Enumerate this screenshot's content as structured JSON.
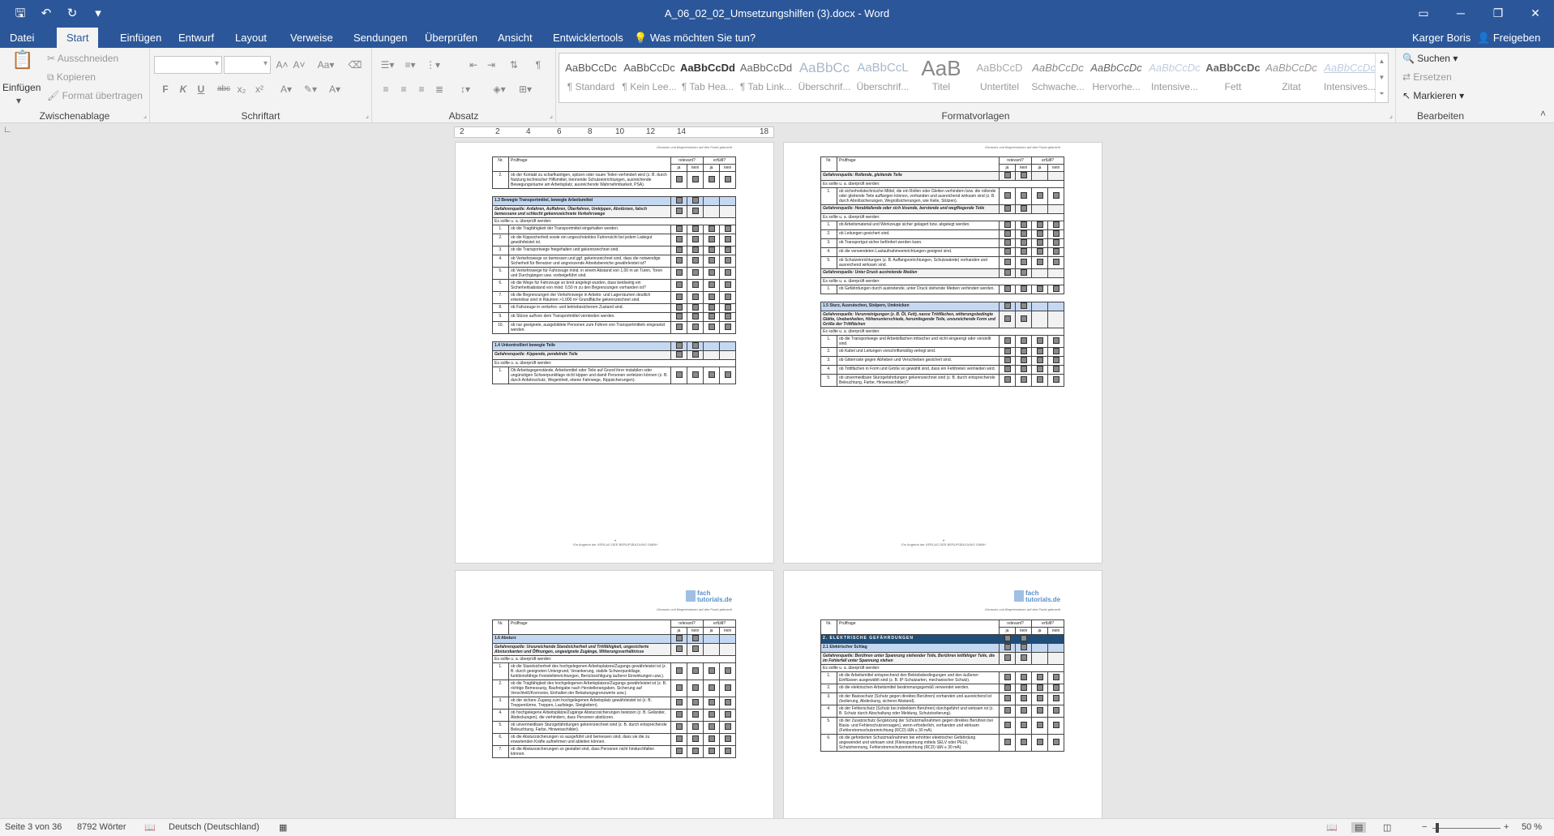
{
  "app": {
    "window_title": "A_06_02_02_Umsetzungshilfen (3).docx - Word",
    "qat": {
      "save": "save-icon",
      "undo": "undo-icon",
      "redo": "redo-icon",
      "customize": "customize-icon"
    },
    "user": "Karger Boris",
    "share": "Freigeben"
  },
  "tabs": [
    {
      "label": "Datei"
    },
    {
      "label": "Start"
    },
    {
      "label": "Einfügen"
    },
    {
      "label": "Entwurf"
    },
    {
      "label": "Layout"
    },
    {
      "label": "Verweise"
    },
    {
      "label": "Sendungen"
    },
    {
      "label": "Überprüfen"
    },
    {
      "label": "Ansicht"
    },
    {
      "label": "Entwicklertools"
    },
    {
      "label": "Was möchten Sie tun?"
    }
  ],
  "ribbon": {
    "clipboard": {
      "label": "Zwischenablage",
      "paste": "Einfügen",
      "cut": "Ausschneiden",
      "copy": "Kopieren",
      "format_painter": "Format übertragen"
    },
    "font": {
      "label": "Schriftart",
      "bold": "F",
      "italic": "K",
      "underline": "U",
      "strike": "abc",
      "sub": "x₂",
      "sup": "x²"
    },
    "paragraph": {
      "label": "Absatz"
    },
    "styles": {
      "label": "Formatvorlagen",
      "items": [
        {
          "preview": "AaBbCcDc",
          "name": "¶ Standard"
        },
        {
          "preview": "AaBbCcDc",
          "name": "¶ Kein Lee..."
        },
        {
          "preview": "AaBbCcDd",
          "name": "¶ Tab Hea..."
        },
        {
          "preview": "AaBbCcDd",
          "name": "¶ Tab Link..."
        },
        {
          "preview": "AaBbCc",
          "name": "Überschrif..."
        },
        {
          "preview": "AaBbCcL",
          "name": "Überschrif..."
        },
        {
          "preview": "AaB",
          "name": "Titel"
        },
        {
          "preview": "AaBbCcD",
          "name": "Untertitel"
        },
        {
          "preview": "AaBbCcDc",
          "name": "Schwache..."
        },
        {
          "preview": "AaBbCcDc",
          "name": "Hervorhe..."
        },
        {
          "preview": "AaBbCcDc",
          "name": "Intensive..."
        },
        {
          "preview": "AaBbCcDc",
          "name": "Fett"
        },
        {
          "preview": "AaBbCcDc",
          "name": "Zitat"
        },
        {
          "preview": "AaBbCcDc",
          "name": "Intensives..."
        }
      ]
    },
    "editing": {
      "label": "Bearbeiten",
      "find": "Suchen",
      "replace": "Ersetzen",
      "select": "Markieren"
    }
  },
  "ruler": {
    "numbers": [
      "2",
      "2",
      "4",
      "6",
      "8",
      "10",
      "12",
      "14",
      "18"
    ]
  },
  "pages": {
    "header_text": "Genaues vnb Begreensbsen auf den Punkt gebracht",
    "footer_text": "Ein Angebot der VERLAG DER BERUFSBILDUNG GMBH",
    "logo_text": "fach tutorials.de",
    "table_head": {
      "nr": "Nr.",
      "question": "Prüffrage",
      "relevant": "relevant?",
      "fulfilled": "erfüllt?",
      "ja": "ja",
      "nein": "nein"
    },
    "intro": "Es sollte u. a. überprüft werden:",
    "p1": {
      "rows": [
        {
          "nr": "2.",
          "text": "ob der Kontakt zu scharfkantigen, spitzen oder rauen Teilen verhindert wird (z. B. durch Nutzung technischer Hilfsmittel, trennende Schutzeinrichtungen, ausreichende Bewegungsräume am Arbeitsplatz, ausreichende Wahrnehmbarkeit, PSA)."
        }
      ],
      "sec1": "1.3 Bewegte Transportmittel, bewegte Arbeitsmittel",
      "haz1": "Gefahrenquelle: Anfahren, Auffahren, Überfahren, Umkippen, Abstürzen, falsch bemessene und schlecht gekennzeichnete Verkehrswege",
      "rows1": [
        {
          "nr": "1.",
          "text": "ob die Tragfähigkeit der Transportmittel eingehalten werden."
        },
        {
          "nr": "2.",
          "text": "ob die Kippsicherheit sowie ein ungeschränktes Fahrersicht bei jedem Ladegut gewährleistet ist."
        },
        {
          "nr": "3.",
          "text": "ob die Transportwege freigehalten und gekennzeichnet sind."
        },
        {
          "nr": "4.",
          "text": "ob Verkehrswege so bemessen und ggf. gekennzeichnet sind, dass die notwendige Sicherheit für Benutzer und angrenzende Arbeitsbereiche gewährleistet ist?"
        },
        {
          "nr": "5.",
          "text": "ob Verkehrswege für Fahrzeuge mind. in einem Abstand von 1,00 m an Türen, Toren und Durchgängen usw. vorbeigeführt sind."
        },
        {
          "nr": "6.",
          "text": "ob die Wege für Fahrzeuge so breit angelegt wurden, dass beidseitig ein Sicherheitsabstand von mind. 0,50 m zu den Begrenzungen vorhanden ist?"
        },
        {
          "nr": "7.",
          "text": "ob die Begrenzungen der Verkehrswege in Arbeits- und Lagerräumen deutlich erkennbar sind in Räumen >1.000 m² Grundfläche gekennzeichnet sind."
        },
        {
          "nr": "8.",
          "text": "ob Fahrzeuge in verkehrs- und betriebssicherem Zustand sind."
        },
        {
          "nr": "9.",
          "text": "ob Stürze auf/von dem Transportmittel vermieden werden."
        },
        {
          "nr": "10.",
          "text": "ob nur geeignete, ausgebildete Personen zum Führen von Transportmitteln eingesetzt werden."
        }
      ],
      "sec2": "1.4 Unkontrolliert bewegte Teile",
      "haz2": "Gefahrenquelle: Kippende, pendelnde Teile",
      "rows2": [
        {
          "nr": "1.",
          "text": "Ob Arbeitsgegenstände, Arbeitsmittel oder Teile auf Grund ihrer instabilen oder ungünstigen Schwerpunktlage nicht kippen und damit Personen verletzen können (z. B. durch Anfahrschutz, Wegeinheit, ebene Fahrwege, Kippsicherungen)."
        }
      ]
    },
    "p2": {
      "haz0": "Gefahrenquelle: Rollende, gleitende Teile",
      "rows0": [
        {
          "nr": "1.",
          "text": "ob sicherheitstechnische Mittel, die ein Rollen oder Gleiten verhindern bzw. die rollende oder gleitende Teile auffangen können, vorhanden und ausreichend wirksam sind (z. B. durch Abrollsicherungen, Wegrollsicherungen, wie Keile, Stützen)."
        }
      ],
      "haz1": "Gefahrenquelle: Herabfallende oder sich lösende, berstende und wegfliegende Teile",
      "rows1": [
        {
          "nr": "1.",
          "text": "ob Arbeitsmaterial und Werkzeuge sicher gelagert bzw. abgelegt werden."
        },
        {
          "nr": "2.",
          "text": "ob Leitungen gesichert sind."
        },
        {
          "nr": "3.",
          "text": "ob Transportgut sicher befördert werden kann."
        },
        {
          "nr": "4.",
          "text": "ob die verwendeten Lastaufnahmeeinrichtungen geeignet sind."
        },
        {
          "nr": "5.",
          "text": "ob Schutzeinrichtungen (z. B. Auffangvorrichtungen, Schutzwände) vorhanden und ausreichend wirksam sind."
        }
      ],
      "haz2": "Gefahrenquelle: Unter Druck austretende Medien",
      "rows2": [
        {
          "nr": "1.",
          "text": "ob Gefährdungen durch austretende, unter Druck stehende Medien verhindert werden."
        }
      ],
      "sec3": "1.5 Sturz, Ausrutschen, Stolpern, Umknicken",
      "haz3": "Gefahrenquelle: Verunreinigungen (z. B. Öl, Fett), nasse Trittflächen, witterungsbedingte Glätte, Unebenheiten, Höhenunterschiede, herumliegende Teile, unzureichende Form und Größe der Trittflächen",
      "rows3": [
        {
          "nr": "1.",
          "text": "ob die Transportwege und Arbeitsflächen trittsicher und nicht eingeengt oder verstellt sind."
        },
        {
          "nr": "2.",
          "text": "ob Kabel und Leitungen vorschriftsmäßig verlegt sind."
        },
        {
          "nr": "3.",
          "text": "ob Gitterroste gegen Abheben und Verschieben gesichert sind."
        },
        {
          "nr": "4.",
          "text": "ob Trittflächen in Form und Größe so gewählt sind, dass ein Fehltreten vermieden wird."
        },
        {
          "nr": "5.",
          "text": "ob unvermeidbare Sturzgefährdungen gekennzeichnet sind (z. B. durch entsprechende Beleuchtung, Farbe, Hinweisschilder)?"
        }
      ]
    },
    "p3": {
      "sec1": "1.6 Absturz",
      "haz1": "Gefahrenquelle: Unzureichende Standsicherheit und Trittfähigkeit, ungesicherte Absturzkanten und Öffnungen, ungeeignete Zugänge, Witterungsverhältnisse",
      "rows1": [
        {
          "nr": "1.",
          "text": "ob die Standsicherheit des hochgelegenen Arbeitsplatzes/Zugangs gewährleistet ist (z. B. durch geeigneten Untergrund, Verankerung, stabile Schwerpunktlage, funktionsfähige Feststelleinrichtungen, Berücksichtigung äußerer Einwirkungen usw.)."
        },
        {
          "nr": "2.",
          "text": "ob die Tragfähigkeit des hochgelegenen Arbeitsplatzes/Zugangs gewährleistet ist (z. B. richtige Bemessung, Baufreigabe nach Herstellerangaben, Sicherung auf Verschleiß/Korrosion, Einhalten der Belastungsgrenzwerte usw.)."
        },
        {
          "nr": "3.",
          "text": "ob der sichere Zugang zum hochgelegenen Arbeitsplatz gewährleistet ist (z. B. Treppentürme, Treppen, Laufstege, Steigleitern)."
        },
        {
          "nr": "4.",
          "text": "ob hochgelegene Arbeitsplätze/Zugänge Absturzsicherungen besitzen (z. B. Geländer, Abdeckungen), die verhindern, dass Personen abstürzen."
        },
        {
          "nr": "5.",
          "text": "ob unvermeidbare Sturzgefährdungen gekennzeichnet sind (z. B. durch entsprechende Beleuchtung, Farbe, Hinweisschilder)."
        },
        {
          "nr": "6.",
          "text": "ob die Absturzsicherungen so ausgeführt und bemessen sind, dass sie die zu erwartenden Kräfte aufnehmen und ableiten können."
        },
        {
          "nr": "7.",
          "text": "ob die Absturzsicherungen so gestaltet sind, dass Personen nicht hindurchfallen können."
        }
      ]
    },
    "p4": {
      "sec0": "2. ELEKTRISCHE GEFÄHRDUNGEN",
      "sec1": "2.1 Elektrischer Schlag",
      "haz1": "Gefahrenquelle: Berühren unter Spannung stehender Teile, Berühren leitfähiger Teile, die im Fehlerfall unter Spannung stehen",
      "rows1": [
        {
          "nr": "1.",
          "text": "ob die Arbeitsmittel entsprechend den Betriebsbedingungen und den äußeren Einflüssen ausgewählt sind (z. B. IP-Schutzarten, mechanischer Schutz)."
        },
        {
          "nr": "2.",
          "text": "ob die elektrischen Arbeitsmittel bestimmungsgemäß verwendet werden."
        },
        {
          "nr": "3.",
          "text": "ob der Basisschutz (Schutz gegen direktes Berühren) vorhanden und ausreichend ist (Isolierung, Abdeckung, sicherer Abstand)."
        },
        {
          "nr": "4.",
          "text": "ob der Fehlerschutz (Schutz bei indirektem Berühren) durchgeführt und wirksam ist (z. B. Schutz durch Abschaltung oder Meldung, Schutzisolierung)."
        },
        {
          "nr": "5.",
          "text": "ob der Zusatzschutz (Ergänzung der Schutzmaßnahmen gegen direktes Berühren bei Basis- und Fehlerschutzversagen), wenn erforderlich, vorhanden und wirksam (Fehlerstromschutzeinrichtung (RCD) IΔN ≤ 30 mA)."
        },
        {
          "nr": "6.",
          "text": "ob die geforderten Schutzmaßnahmen bei erhöhter elektrischer Gefährdung angewendet und wirksam sind (Kleinspannung mittels SELV oder PELV, Schutztrennung, Fehlerstromschutzeinrichtung (RCD) IΔN ≤ 30 mA)."
        }
      ]
    }
  },
  "status": {
    "page": "Seite 3 von 36",
    "words": "8792 Wörter",
    "language": "Deutsch (Deutschland)",
    "zoom": "50 %"
  }
}
